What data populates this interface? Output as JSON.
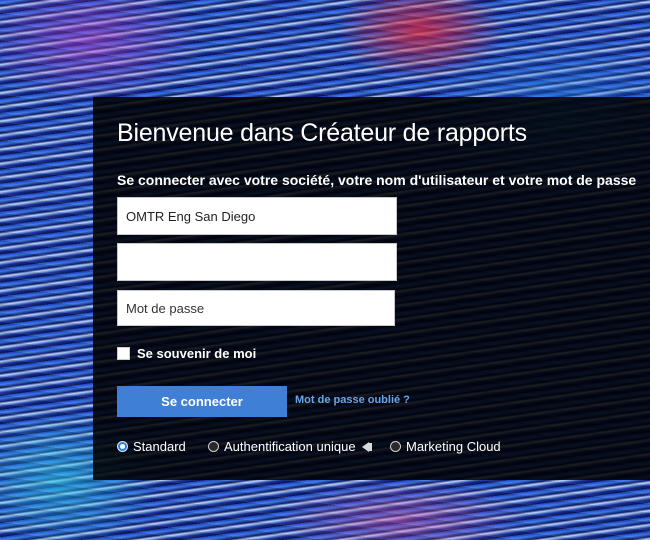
{
  "login": {
    "title": "Bienvenue dans Créateur de rapports",
    "subtitle": "Se connecter avec votre société, votre nom d'utilisateur et votre mot de passe",
    "company_value": "OMTR Eng San Diego",
    "username_value": "",
    "password_placeholder": "Mot de passe",
    "remember_label": "Se souvenir de moi",
    "login_button": "Se connecter",
    "forgot_link": "Mot de passe oublié ?",
    "auth_options": [
      {
        "label": "Standard",
        "selected": true
      },
      {
        "label": "Authentification unique",
        "selected": false
      },
      {
        "label": "Marketing Cloud",
        "selected": false
      }
    ]
  },
  "colors": {
    "button": "#3f7fd5",
    "link": "#6aa4ea",
    "panel": "rgba(0,0,0,0.86)"
  },
  "icons": {
    "sso_info": "info-arrow-icon"
  }
}
